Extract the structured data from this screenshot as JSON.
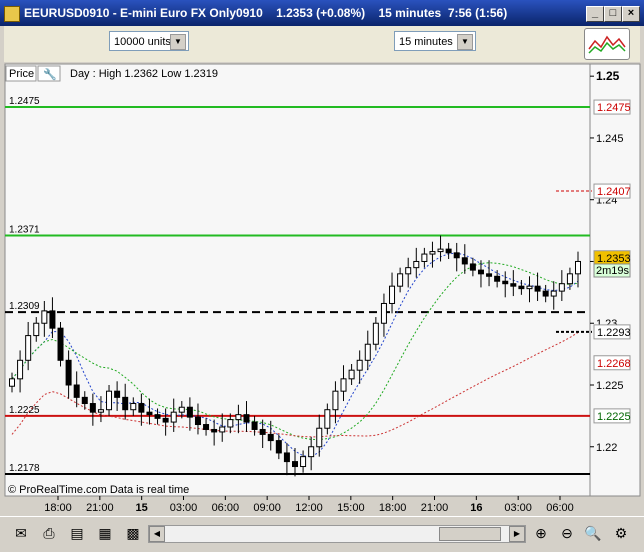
{
  "window": {
    "title": "EEURUSD0910 - E-mini Euro FX Only0910    1.2353 (+0.08%)    15 minutes  7:56 (1:56)",
    "buttons": [
      "_",
      "□",
      "×"
    ]
  },
  "toolbar": {
    "quantity_value": "10000 units",
    "interval_value": "15 minutes"
  },
  "chart_panel": {
    "price_label": "Price",
    "info": "Day : High 1.2362 Low 1.2319",
    "footer": "© ProRealTime.com  Data is real time",
    "current_price": "1.2353",
    "countdown": "2m19s"
  },
  "chart_data": {
    "type": "candlestick",
    "x_ticks": [
      "18:00",
      "21:00",
      "15",
      "03:00",
      "06:00",
      "09:00",
      "12:00",
      "15:00",
      "18:00",
      "21:00",
      "16",
      "03:00",
      "06:00"
    ],
    "y_ticks": [
      "1.25",
      "1.245",
      "1.24",
      "1.235",
      "1.23",
      "1.225",
      "1.22"
    ],
    "ylim": [
      1.2165,
      1.2505
    ],
    "horizontal_lines": [
      {
        "value": 1.2475,
        "label": "1.2475",
        "color": "#22bb22",
        "style": "solid"
      },
      {
        "value": 1.2371,
        "label": "1.2371",
        "color": "#22bb22",
        "style": "solid"
      },
      {
        "value": 1.2309,
        "label": "1.2309",
        "color": "#000000",
        "style": "dashed"
      },
      {
        "value": 1.2225,
        "label": "1.2225",
        "color": "#cc1111",
        "style": "solid"
      },
      {
        "value": 1.2178,
        "label": "1.2178",
        "color": "#000000",
        "style": "solid"
      }
    ],
    "right_tags": [
      {
        "value": 1.2475,
        "label": "1.2475",
        "color": "#cc0000",
        "bg": "#ffffff",
        "line": "none"
      },
      {
        "value": 1.2407,
        "label": "1.2407",
        "color": "#cc0000",
        "bg": "#ffffff",
        "line": "dashed-red"
      },
      {
        "value": 1.2353,
        "label": "1.2353",
        "color": "#000000",
        "bg": "#f0c000",
        "line": "none"
      },
      {
        "value": 1.2293,
        "label": "1.2293",
        "color": "#000000",
        "bg": "#ffffff",
        "line": "dashed-black"
      },
      {
        "value": 1.2268,
        "label": "1.2268",
        "color": "#cc0000",
        "bg": "#ffffff",
        "line": "none"
      },
      {
        "value": 1.2225,
        "label": "1.2225",
        "color": "#006600",
        "bg": "#ffffff",
        "line": "none"
      }
    ],
    "candles_close": [
      1.2255,
      1.227,
      1.229,
      1.23,
      1.231,
      1.2296,
      1.227,
      1.225,
      1.224,
      1.2235,
      1.2228,
      1.223,
      1.2245,
      1.224,
      1.223,
      1.2235,
      1.2228,
      1.2226,
      1.2223,
      1.222,
      1.2228,
      1.2232,
      1.2224,
      1.2218,
      1.2214,
      1.2212,
      1.2216,
      1.2222,
      1.2226,
      1.222,
      1.2214,
      1.221,
      1.2205,
      1.2195,
      1.2188,
      1.2184,
      1.2192,
      1.22,
      1.2215,
      1.223,
      1.2245,
      1.2255,
      1.2262,
      1.227,
      1.2283,
      1.23,
      1.2316,
      1.233,
      1.234,
      1.2345,
      1.235,
      1.2356,
      1.2358,
      1.236,
      1.2357,
      1.2353,
      1.2348,
      1.2343,
      1.234,
      1.2338,
      1.2334,
      1.2332,
      1.233,
      1.2328,
      1.233,
      1.2326,
      1.2322,
      1.2326,
      1.2332,
      1.234,
      1.235
    ],
    "ma_series": [
      {
        "color": "#2244cc",
        "style": "dashed"
      },
      {
        "color": "#22aa22",
        "style": "dashed"
      },
      {
        "color": "#cc3333",
        "style": "dashed"
      }
    ]
  },
  "statusbar": {
    "icons": [
      "email-icon",
      "print-icon",
      "chart-icon",
      "grid-icon",
      "color-icon",
      "zoom-fit-icon",
      "zoom-out-icon",
      "zoom-in-icon",
      "settings-icon"
    ]
  }
}
